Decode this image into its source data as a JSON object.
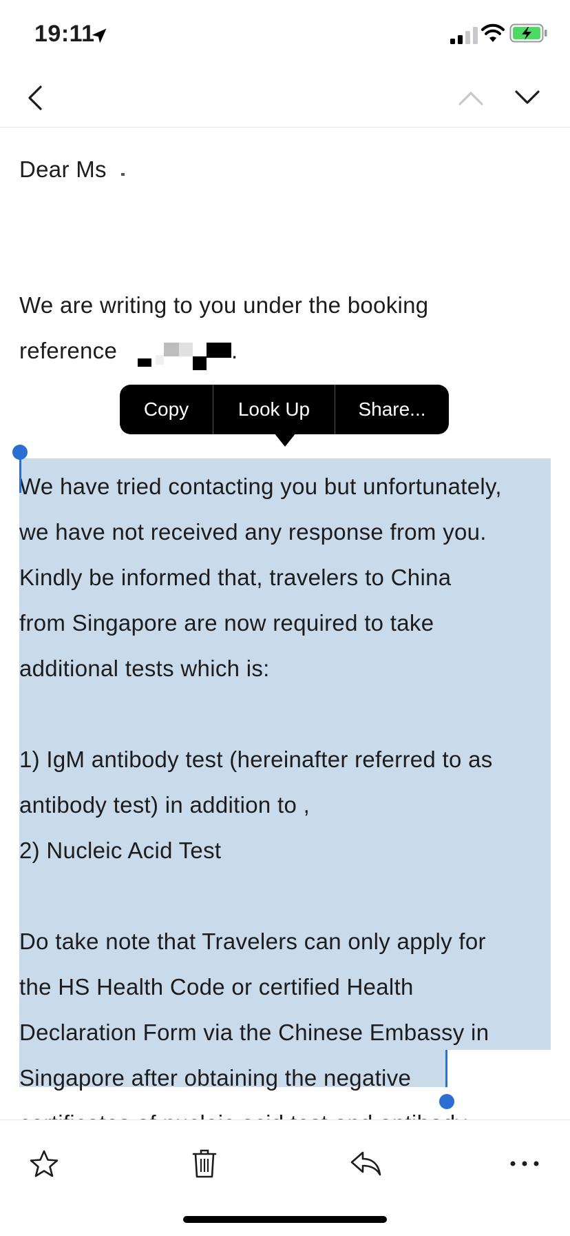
{
  "status": {
    "time": "19:11",
    "icons": [
      "location-arrow-icon",
      "signal-icon",
      "wifi-icon",
      "battery-charging-icon"
    ],
    "battery_color": "#4cd964"
  },
  "nav": {
    "icons": [
      "back-chevron-icon",
      "previous-message-chevron-up-icon",
      "next-message-chevron-down-icon"
    ],
    "up_disabled_color": "#c7c7cc"
  },
  "email": {
    "greeting": "Dear Ms",
    "intro_line1": "We are writing to you under the booking",
    "intro_line2_prefix": "reference",
    "intro_line2_suffix": ".",
    "lines": [
      "We have tried contacting you but unfortunately,",
      "we have not received any response from you.",
      "Kindly be informed that, travelers to China",
      "from Singapore are now required to take",
      "additional tests which is:",
      "",
      "1) IgM antibody test (hereinafter referred to as",
      "antibody test) in addition to ,",
      "2) Nucleic Acid Test",
      "",
      "Do take note that Travelers can only apply for",
      "the HS Health Code or certified Health",
      "Declaration Form via the Chinese Embassy in",
      "Singapore after obtaining the negative",
      "certificates of nucleic acid test and antibody"
    ],
    "selection_color": "#c9dbea"
  },
  "context_menu": {
    "copy": "Copy",
    "look_up": "Look Up",
    "share": "Share..."
  },
  "toolbar": {
    "icons": [
      "star-icon",
      "trash-icon",
      "reply-icon",
      "more-icon"
    ]
  }
}
